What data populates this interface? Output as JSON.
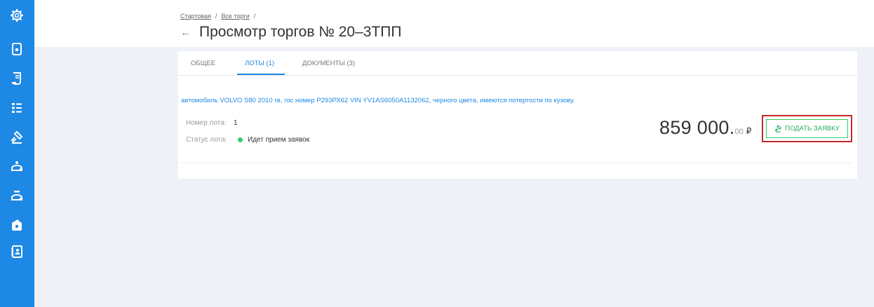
{
  "sidebar": {
    "icons": [
      "gear-icon",
      "document-icon",
      "contract-icon",
      "list-icon",
      "gavel-icon",
      "auction-icon",
      "auction-alt-icon",
      "wallet-icon",
      "address-book-icon"
    ]
  },
  "breadcrumb": {
    "home": "Стартовая",
    "sep1": "/",
    "all_trades": "Все торги",
    "sep2": "/"
  },
  "header": {
    "back_icon": "arrow-left-icon",
    "title": "Просмотр торгов № 20–3ТПП"
  },
  "tabs": [
    {
      "label": "ОБЩЕЕ",
      "active": false
    },
    {
      "label": "ЛОТЫ (1)",
      "active": true
    },
    {
      "label": "ДОКУМЕНТЫ (3)",
      "active": false
    }
  ],
  "lot": {
    "description": "автомобиль VOLVO S80 2010 гв, гос номер Р293РХ62 VIN YV1AS6050A1132062, черного цвета, имеются потертости по кузову.",
    "number_label": "Номер лота:",
    "number_value": "1",
    "status_label": "Статус лота:",
    "status_value": "Идет прием заявок",
    "price_main": "859 000.",
    "price_cents": "00",
    "currency": "₽",
    "bid_button_label": "ПОДАТЬ ЗАЯВКУ"
  },
  "colors": {
    "sidebar": "#1e88e5",
    "accent": "#1e88e5",
    "status_ok": "#2ecc71",
    "highlight": "#c62828"
  }
}
